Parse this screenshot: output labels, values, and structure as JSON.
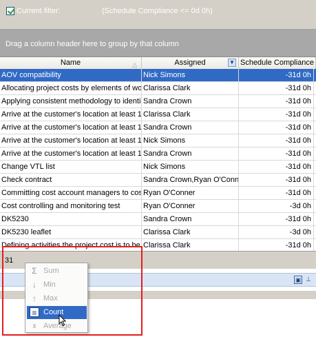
{
  "filter": {
    "checked": true,
    "label": "Current filter:",
    "expression": "(Schedule Compliance  <= 0d 0h)"
  },
  "group_panel": {
    "hint": "Drag a column header here to group by that column"
  },
  "columns": [
    {
      "label": "Name",
      "sort": "ascending"
    },
    {
      "label": "Assigned",
      "filter_icon": "dropdown-arrow-icon"
    },
    {
      "label": "Schedule Compliance"
    }
  ],
  "rows": [
    {
      "name": "AOV compatibility",
      "assigned": "Nick Simons",
      "compliance": "-31d 0h",
      "selected": true
    },
    {
      "name": "Allocating project costs by elements of wo",
      "assigned": "Clarissa Clark",
      "compliance": "-31d 0h"
    },
    {
      "name": "Applying consistent methodology to identil",
      "assigned": "Sandra Crown",
      "compliance": "-31d 0h"
    },
    {
      "name": "Arrive at the customer's location at least 1",
      "assigned": "Clarissa Clark",
      "compliance": "-31d 0h"
    },
    {
      "name": "Arrive at the customer's location at least 1",
      "assigned": "Sandra Crown",
      "compliance": "-31d 0h"
    },
    {
      "name": "Arrive at the customer's location at least 1",
      "assigned": "Nick Simons",
      "compliance": "-31d 0h"
    },
    {
      "name": "Arrive at the customer's location at least 1",
      "assigned": "Sandra Crown",
      "compliance": "-31d 0h"
    },
    {
      "name": "Change VTL list",
      "assigned": "Nick Simons",
      "compliance": "-31d 0h"
    },
    {
      "name": "Check contract",
      "assigned": "Sandra Crown,Ryan O'Conn",
      "compliance": "-31d 0h"
    },
    {
      "name": "Committing cost account managers to cost",
      "assigned": "Ryan O'Conner",
      "compliance": "-31d 0h"
    },
    {
      "name": "Cost controlling and monitoring test",
      "assigned": "Ryan O'Conner",
      "compliance": "-3d 0h"
    },
    {
      "name": "DK5230",
      "assigned": "Sandra Crown",
      "compliance": "-31d 0h"
    },
    {
      "name": "DK5230 leaflet",
      "assigned": "Clarissa Clark",
      "compliance": "-3d 0h"
    },
    {
      "name": "Defining activities the project cost is to be",
      "assigned": "Clarissa Clark",
      "compliance": "-31d 0h"
    }
  ],
  "footer": {
    "count": "31"
  },
  "summary_menu": [
    {
      "label": "Sum",
      "icon": "sigma-icon",
      "enabled": false
    },
    {
      "label": "Min",
      "icon": "min-icon",
      "enabled": false
    },
    {
      "label": "Max",
      "icon": "max-icon",
      "enabled": false
    },
    {
      "label": "Count",
      "icon": "count-icon",
      "enabled": true,
      "active": true
    },
    {
      "label": "Average",
      "icon": "average-icon",
      "enabled": false
    }
  ],
  "colors": {
    "selection": "#316ac5",
    "highlight_box": "#e31c1c"
  }
}
